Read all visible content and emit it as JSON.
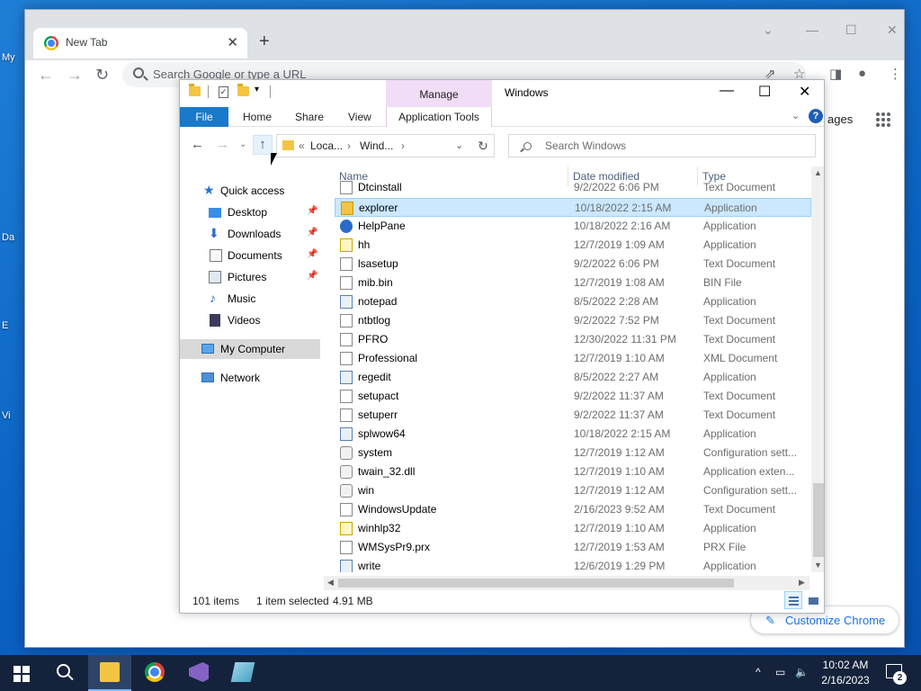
{
  "desktop": {
    "labels": [
      "My",
      "Da",
      "E",
      "Vi"
    ]
  },
  "chrome": {
    "tab_title": "New Tab",
    "omnibox_placeholder": "Search Google or type a URL",
    "images_link": "ages",
    "customize_label": "Customize Chrome"
  },
  "explorer": {
    "contextual_tab": "Manage",
    "window_title": "Windows",
    "ribbon": {
      "file": "File",
      "home": "Home",
      "share": "Share",
      "view": "View",
      "app_tools": "Application Tools"
    },
    "address": {
      "prefix": "«",
      "seg1": "Loca...",
      "seg2": "Wind...",
      "sep": "›"
    },
    "search_placeholder": "Search Windows",
    "nav": {
      "quick_access": "Quick access",
      "desktop": "Desktop",
      "downloads": "Downloads",
      "documents": "Documents",
      "pictures": "Pictures",
      "music": "Music",
      "videos": "Videos",
      "my_computer": "My Computer",
      "network": "Network"
    },
    "columns": {
      "name": "Name",
      "date": "Date modified",
      "type": "Type"
    },
    "files": [
      {
        "name": "Dtcinstall",
        "date": "9/2/2022 6:06 PM",
        "type": "Text Document",
        "icon": "doc"
      },
      {
        "name": "explorer",
        "date": "10/18/2022 2:15 AM",
        "type": "Application",
        "icon": "folderish"
      },
      {
        "name": "HelpPane",
        "date": "10/18/2022 2:16 AM",
        "type": "Application",
        "icon": "help"
      },
      {
        "name": "hh",
        "date": "12/7/2019 1:09 AM",
        "type": "Application",
        "icon": "yellow"
      },
      {
        "name": "lsasetup",
        "date": "9/2/2022 6:06 PM",
        "type": "Text Document",
        "icon": "doc"
      },
      {
        "name": "mib.bin",
        "date": "12/7/2019 1:08 AM",
        "type": "BIN File",
        "icon": "doc"
      },
      {
        "name": "notepad",
        "date": "8/5/2022 2:28 AM",
        "type": "Application",
        "icon": "app"
      },
      {
        "name": "ntbtlog",
        "date": "9/2/2022 7:52 PM",
        "type": "Text Document",
        "icon": "doc"
      },
      {
        "name": "PFRO",
        "date": "12/30/2022 11:31 PM",
        "type": "Text Document",
        "icon": "doc"
      },
      {
        "name": "Professional",
        "date": "12/7/2019 1:10 AM",
        "type": "XML Document",
        "icon": "doc"
      },
      {
        "name": "regedit",
        "date": "8/5/2022 2:27 AM",
        "type": "Application",
        "icon": "app"
      },
      {
        "name": "setupact",
        "date": "9/2/2022 11:37 AM",
        "type": "Text Document",
        "icon": "doc"
      },
      {
        "name": "setuperr",
        "date": "9/2/2022 11:37 AM",
        "type": "Text Document",
        "icon": "doc"
      },
      {
        "name": "splwow64",
        "date": "10/18/2022 2:15 AM",
        "type": "Application",
        "icon": "app"
      },
      {
        "name": "system",
        "date": "12/7/2019 1:12 AM",
        "type": "Configuration sett...",
        "icon": "gear"
      },
      {
        "name": "twain_32.dll",
        "date": "12/7/2019 1:10 AM",
        "type": "Application exten...",
        "icon": "gear"
      },
      {
        "name": "win",
        "date": "12/7/2019 1:12 AM",
        "type": "Configuration sett...",
        "icon": "gear"
      },
      {
        "name": "WindowsUpdate",
        "date": "2/16/2023 9:52 AM",
        "type": "Text Document",
        "icon": "doc"
      },
      {
        "name": "winhlp32",
        "date": "12/7/2019 1:10 AM",
        "type": "Application",
        "icon": "yellow"
      },
      {
        "name": "WMSysPr9.prx",
        "date": "12/7/2019 1:53 AM",
        "type": "PRX File",
        "icon": "doc"
      },
      {
        "name": "write",
        "date": "12/6/2019 1:29 PM",
        "type": "Application",
        "icon": "app"
      }
    ],
    "selected_index": 1,
    "status": {
      "count": "101 items",
      "selected": "1 item selected",
      "size": "4.91 MB"
    }
  },
  "taskbar": {
    "time": "10:02 AM",
    "date": "2/16/2023",
    "notification_count": "2"
  }
}
